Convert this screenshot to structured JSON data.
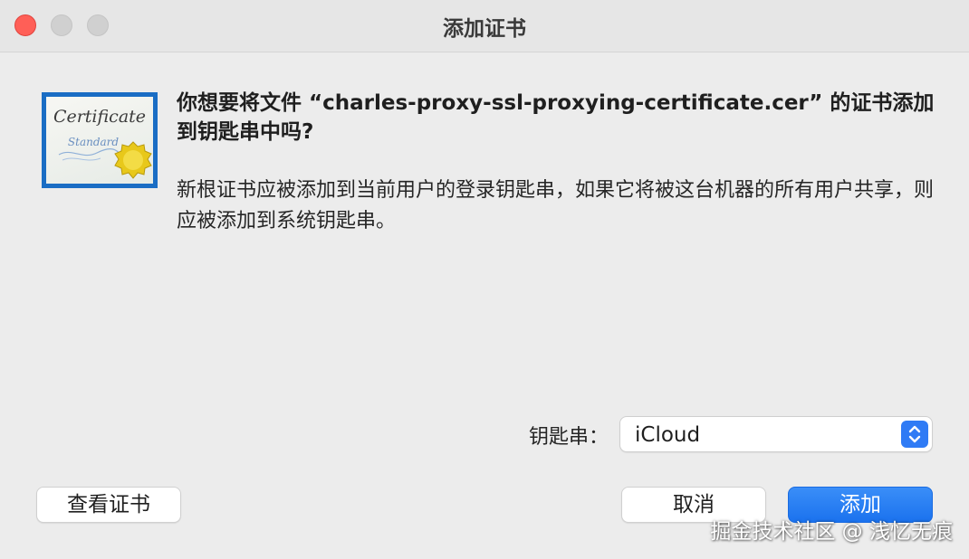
{
  "window": {
    "title": "添加证书"
  },
  "icon": {
    "name": "certificate-icon",
    "line1": "Certificate",
    "line2": "Standard"
  },
  "message": {
    "heading": "你想要将文件 “charles-proxy-ssl-proxying-certificate.cer” 的证书添加到钥匙串中吗?",
    "body": "新根证书应被添加到当前用户的登录钥匙串，如果它将被这台机器的所有用户共享，则应被添加到系统钥匙串。"
  },
  "keychain": {
    "label": "钥匙串：",
    "value": "iCloud"
  },
  "buttons": {
    "view_certificate": "查看证书",
    "cancel": "取消",
    "add": "添加"
  },
  "watermark": "掘金技术社区 @ 浅忆无痕",
  "colors": {
    "accent": "#1b72ee",
    "close": "#ff5f57"
  }
}
